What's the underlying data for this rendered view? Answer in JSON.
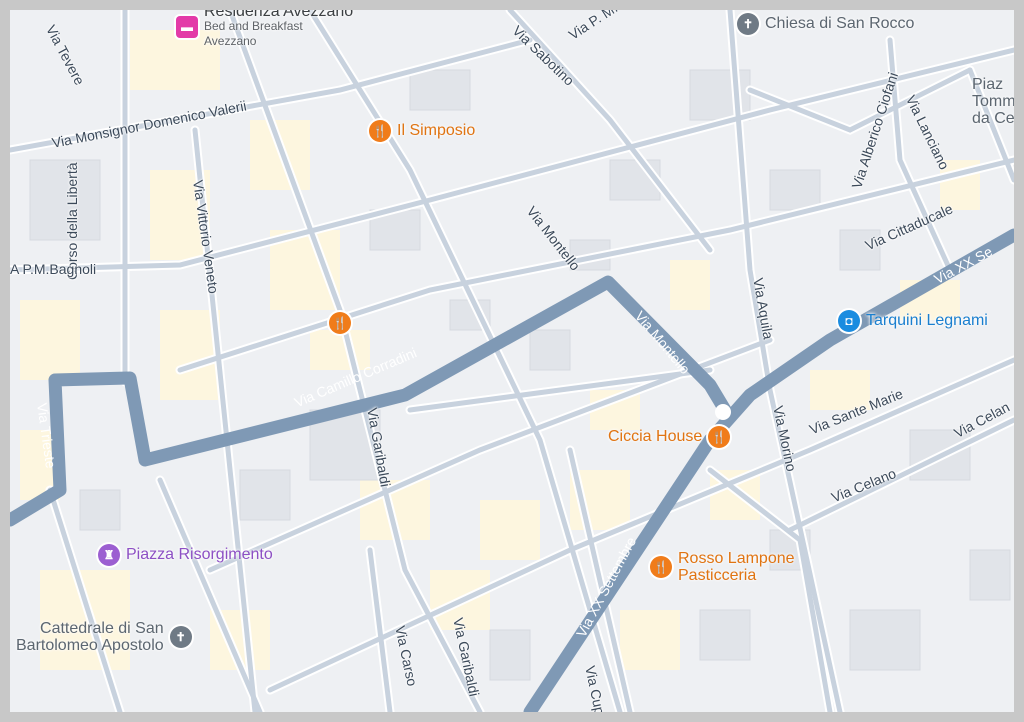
{
  "map": {
    "pois": {
      "residenza": {
        "name": "Residenza Avezzano",
        "sub1": "Bed and Breakfast",
        "sub2": "Avezzano",
        "icon": "hotel-icon"
      },
      "il_simposio": {
        "name": "Il Simposio",
        "icon": "restaurant-icon"
      },
      "unnamed_restaurant": {
        "icon": "restaurant-icon"
      },
      "chiesa_san_rocco": {
        "name": "Chiesa di San Rocco",
        "icon": "church-icon"
      },
      "tarquini": {
        "name": "Tarquini Legnami",
        "icon": "shopping-bag-icon"
      },
      "ciccia_house": {
        "name": "Ciccia House",
        "icon": "restaurant-icon"
      },
      "rosso_lampone": {
        "line1": "Rosso Lampone",
        "line2": "Pasticceria",
        "icon": "restaurant-icon"
      },
      "piazza_risorgimento": {
        "name": "Piazza Risorgimento",
        "icon": "castle-icon"
      },
      "cattedrale": {
        "line1": "Cattedrale di San",
        "line2": "Bartolomeo Apostolo",
        "icon": "church-icon"
      },
      "piazza_top": {
        "line1": "Piaz",
        "line2": "Tomm",
        "line3": "da Ce"
      }
    },
    "streets": {
      "via_tevere": "Via Tevere",
      "via_sabotino": "Via Sabotino",
      "via_pm_top": "Via P. M.",
      "via_monsignor": "Via Monsignor Domenico Valerii",
      "via_vittorio_veneto": "Via Vittorio Veneto",
      "corso_liberta": "Corso della Libertà",
      "via_pm_bagnoli": "A P.M.Bagnoli",
      "via_trieste": "Via Trieste",
      "via_camillo": "Via Camillo Corradini",
      "via_garibaldi_1": "Via Garibaldi",
      "via_garibaldi_2": "Via Garibaldi",
      "via_montello_1": "Via Montello",
      "via_montello_2": "Via Montello",
      "via_aquila": "Via Aquila",
      "via_xx_1": "Via XX Settembre",
      "via_xx_2": "Via XX Se",
      "via_morino": "Via Morino",
      "via_sante_marie": "Via Sante Marie",
      "via_celano_1": "Via Celano",
      "via_celano_2": "Via Celan",
      "via_cittaducale": "Via Cittaducale",
      "via_alberico": "Via Alberico Ciofani",
      "via_lanciano": "Via Lanciano",
      "via_carso": "Via Carso",
      "via_cupe": "Via Cupe"
    },
    "colors": {
      "background": "#eef0f3",
      "block": "#fdf6df",
      "building": "#e3e6ea",
      "minor_road": "#c9d3de",
      "main_road": "#7f99b5",
      "food": "#f07c1a"
    }
  }
}
